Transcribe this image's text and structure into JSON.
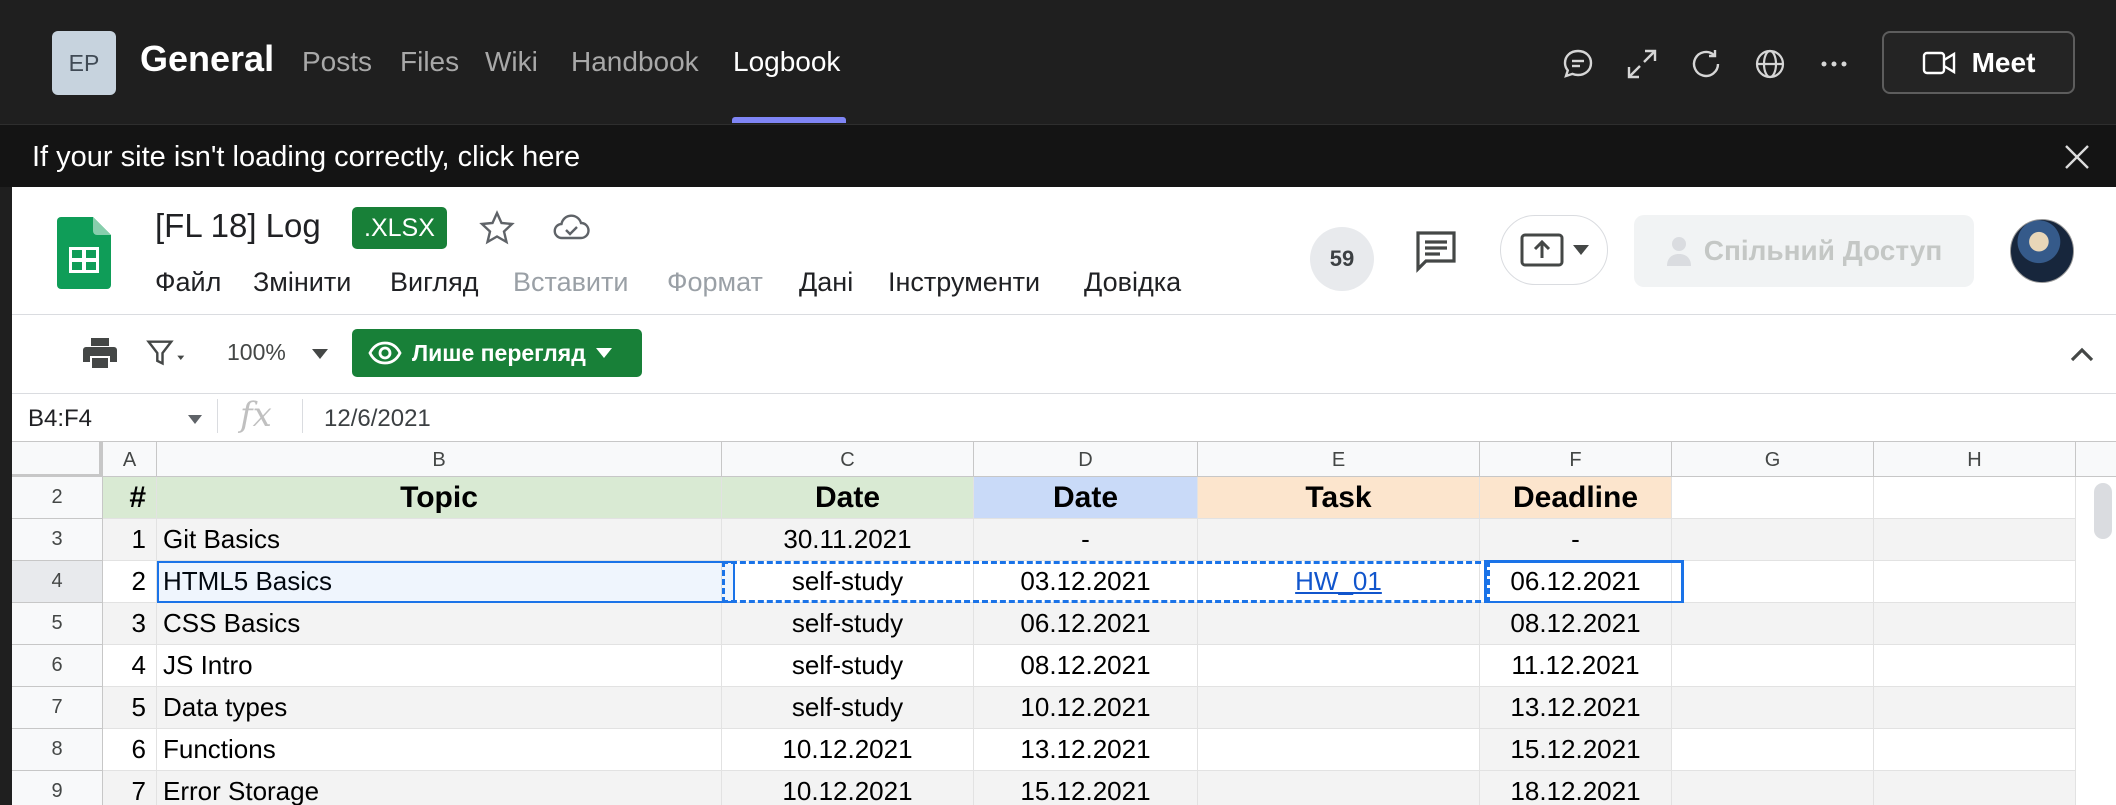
{
  "teams": {
    "avatar_initials": "EP",
    "team_name": "General",
    "tabs": [
      {
        "label": "Posts"
      },
      {
        "label": "Files"
      },
      {
        "label": "Wiki"
      },
      {
        "label": "Handbook"
      },
      {
        "label": "Logbook",
        "active": true
      }
    ],
    "meet_label": "Meet",
    "accent_color": "#7f85f5"
  },
  "notice": {
    "text": "If your site isn't loading correctly, click here"
  },
  "sheet": {
    "title": "[FL 18] Log",
    "badge": ".XLSX",
    "menu": [
      "Файл",
      "Змінити",
      "Вигляд",
      "Вставити",
      "Формат",
      "Дані",
      "Інструменти",
      "Довідка"
    ],
    "viewers_count": "59",
    "share_label": "Спільний Доступ",
    "zoom": "100%",
    "view_only_label": "Лише перегляд",
    "name_box": "B4:F4",
    "formula_value": "12/6/2021",
    "columns": [
      "A",
      "B",
      "C",
      "D",
      "E",
      "F",
      "G",
      "H"
    ],
    "header_row": {
      "num": "2",
      "cells": [
        "#",
        "Topic",
        "Date",
        "Date",
        "Task",
        "Deadline"
      ]
    },
    "rows": [
      {
        "num": "3",
        "cells": [
          "1",
          "Git Basics",
          "30.11.2021",
          "-",
          "",
          "-"
        ]
      },
      {
        "num": "4",
        "cells": [
          "2",
          "HTML5 Basics",
          "self-study",
          "03.12.2021",
          "HW_01",
          "06.12.2021"
        ]
      },
      {
        "num": "5",
        "cells": [
          "3",
          "CSS Basics",
          "self-study",
          "06.12.2021",
          "",
          "08.12.2021"
        ]
      },
      {
        "num": "6",
        "cells": [
          "4",
          "JS Intro",
          "self-study",
          "08.12.2021",
          "",
          "11.12.2021"
        ]
      },
      {
        "num": "7",
        "cells": [
          "5",
          "Data types",
          "self-study",
          "10.12.2021",
          "",
          "13.12.2021"
        ]
      },
      {
        "num": "8",
        "cells": [
          "6",
          "Functions",
          "10.12.2021",
          "13.12.2021",
          "",
          "15.12.2021"
        ]
      },
      {
        "num": "9",
        "cells": [
          "7",
          "Error Storage",
          "10.12.2021",
          "15.12.2021",
          "",
          "18.12.2021"
        ]
      }
    ],
    "header_colors": {
      "A": "#d9ead3",
      "B": "#d9ead3",
      "C": "#d9ead3",
      "D": "#c9daf8",
      "E": "#fce5cd",
      "F": "#fce5cd"
    },
    "icons": [
      "print-icon",
      "filter-icon",
      "eye-icon",
      "comments-icon",
      "present-icon",
      "person-icon",
      "star-icon",
      "cloud-icon",
      "collapse-icon"
    ]
  }
}
